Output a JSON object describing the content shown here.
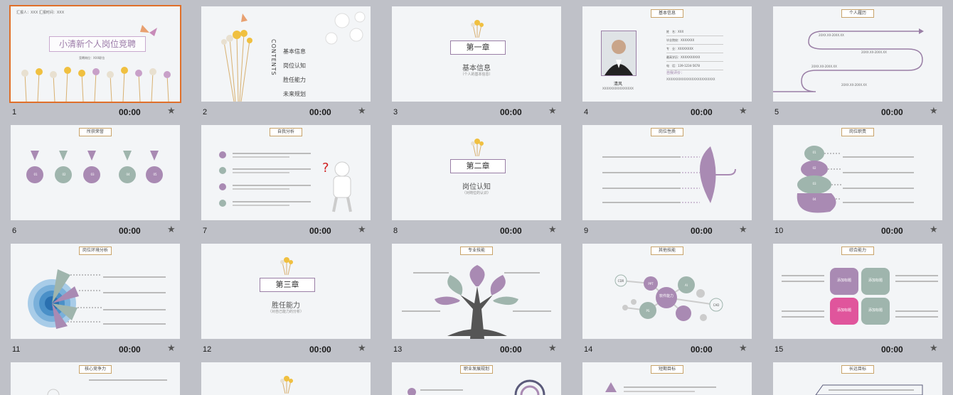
{
  "slides": [
    {
      "num": "1",
      "time": "00:00",
      "title": "小清新个人岗位竞聘",
      "header_left": "汇报人：XXX  汇报时间：XXX",
      "subtitle": "竞聘岗位：XXX职位"
    },
    {
      "num": "2",
      "time": "00:00",
      "contents_label": "CONTENTS",
      "items": [
        "基本信息",
        "岗位认知",
        "胜任能力",
        "未来规划"
      ]
    },
    {
      "num": "3",
      "time": "00:00",
      "chapter": "第一章",
      "heading": "基本信息",
      "sub": "（个人的基本信息）"
    },
    {
      "num": "4",
      "time": "00:00",
      "tag": "基本信息",
      "person_name": "清风",
      "person_caption": "XXXXXXXXXXXXXXXX",
      "fields": [
        "姓　名：XXX",
        "毕业院校：XXXXXXX",
        "专　业：XXXXXXXX",
        "最高学历：XXXXXXXXXX",
        "电　话：139-1234-5678"
      ],
      "eval_label": "自我评价：",
      "eval_text": "XXXXXXXXXXXXXXXXXXXXXXXXX"
    },
    {
      "num": "5",
      "time": "00:00",
      "tag": "个人履历",
      "timeline": [
        "20XX.XX-20XX.XX",
        "20XX.XX-20XX.XX",
        "20XX.XX-20XX.XX",
        "20XX.XX-20XX.XX"
      ]
    },
    {
      "num": "6",
      "time": "00:00",
      "tag": "所获荣誉",
      "medals": [
        "01",
        "02",
        "03",
        "04",
        "05"
      ]
    },
    {
      "num": "7",
      "time": "00:00",
      "tag": "自我分析",
      "rows": [
        "01",
        "02",
        "03",
        "04"
      ]
    },
    {
      "num": "8",
      "time": "00:00",
      "chapter": "第二章",
      "heading": "岗位认知",
      "sub": "（对岗位的认识）"
    },
    {
      "num": "9",
      "time": "00:00",
      "tag": "岗位性质"
    },
    {
      "num": "10",
      "time": "00:00",
      "tag": "岗位职责",
      "steps": [
        "01",
        "02",
        "03",
        "04"
      ]
    },
    {
      "num": "11",
      "time": "00:00",
      "tag": "岗位环境分析"
    },
    {
      "num": "12",
      "time": "00:00",
      "chapter": "第三章",
      "heading": "胜任能力",
      "sub": "（对自己能力的分析）"
    },
    {
      "num": "13",
      "time": "00:00",
      "tag": "专业技能"
    },
    {
      "num": "14",
      "time": "00:00",
      "tag": "其他技能",
      "center": "软件能力",
      "nodes": [
        "PPT",
        "PS",
        "AI",
        "CAD",
        "CDR"
      ]
    },
    {
      "num": "15",
      "time": "00:00",
      "tag": "综合能力",
      "quadrants": [
        "添加标题",
        "添加标题",
        "添加标题",
        "添加标题"
      ]
    },
    {
      "tag": "核心竞争力"
    },
    {},
    {
      "tag": "职业发展规划"
    },
    {
      "tag": "短期目标"
    },
    {
      "tag": "长远目标"
    }
  ]
}
